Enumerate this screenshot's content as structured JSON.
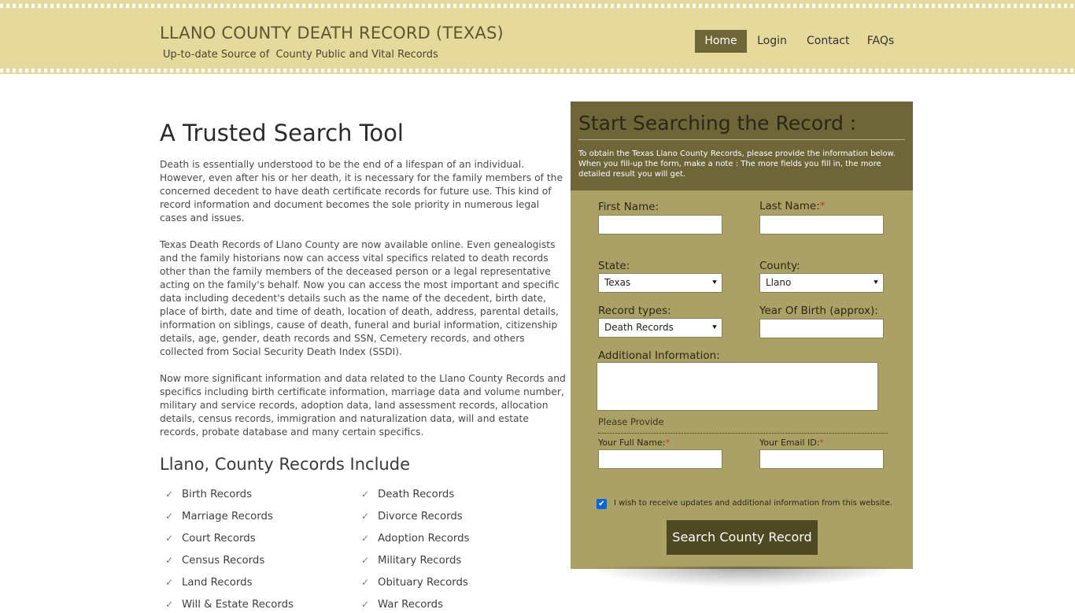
{
  "header": {
    "title": "LLANO COUNTY DEATH RECORD (TEXAS)",
    "tagline": "Up-to-date Source of  County Public and Vital Records"
  },
  "nav": {
    "home": "Home",
    "login": "Login",
    "contact": "Contact",
    "faqs": "FAQs"
  },
  "content": {
    "heading": "A Trusted Search Tool",
    "paragraphs": [
      "Death is essentially understood to be the end of a lifespan of an individual. However, even after his or her death, it is necessary for the family members of the concerned decedent to have death certificate records for future use. This kind of record information and document becomes the sole priority in numerous legal cases and issues.",
      "Texas Death Records of Llano County are now available online. Even genealogists and the family historians now can access vital specifics related to death records other than the family members of the deceased person or a legal representative acting on the family's behalf. Now you can access the most important and specific data including decedent's details such as the name of the decedent, birth date, place of birth, date and time of death, location of death, address, parental details, information on siblings, cause of death, funeral and burial information, citizenship details, age, gender, death records and SSN, Cemetery records, and others collected from Social Security Death Index (SSDI).",
      "Now more significant information and data related to the Llano County Records and specifics including birth certificate information, marriage data and volume number, military and service records, adoption data, land assessment records, allocation details, census records, immigration and naturalization data, will and estate records, probate database and many certain specifics."
    ],
    "records_heading": "Llano, County Records Include",
    "records": [
      "Birth Records",
      "Death Records",
      "Marriage Records",
      "Divorce Records",
      "Court Records",
      "Adoption Records",
      "Census Records",
      "Military Records",
      "Land Records",
      "Obituary Records",
      "Will & Estate Records",
      "War Records"
    ]
  },
  "form": {
    "title": "Start Searching the Record :",
    "description": "To obtain the Texas Llano County Records, please provide the information below. When you fill-up the form, make a note : The more fields you fill in, the more detailed result you will get.",
    "first_name_label": "First Name:",
    "last_name_label": "Last Name:",
    "required_mark": "*",
    "state_label": "State:",
    "state_value": "Texas",
    "county_label": "County:",
    "county_value": "Llano",
    "record_types_label": "Record types:",
    "record_types_value": "Death Records",
    "yob_label": "Year Of Birth (approx):",
    "additional_label": "Additional Information:",
    "please_provide": "Please Provide",
    "full_name_label": "Your Full Name:",
    "email_label": "Your Email ID:",
    "updates_label": "I wish to receive updates and additional information from this website.",
    "submit_label": "Search County Record"
  },
  "icons": {
    "check": "checkmark-icon",
    "dropdown": "chevron-down-icon"
  }
}
